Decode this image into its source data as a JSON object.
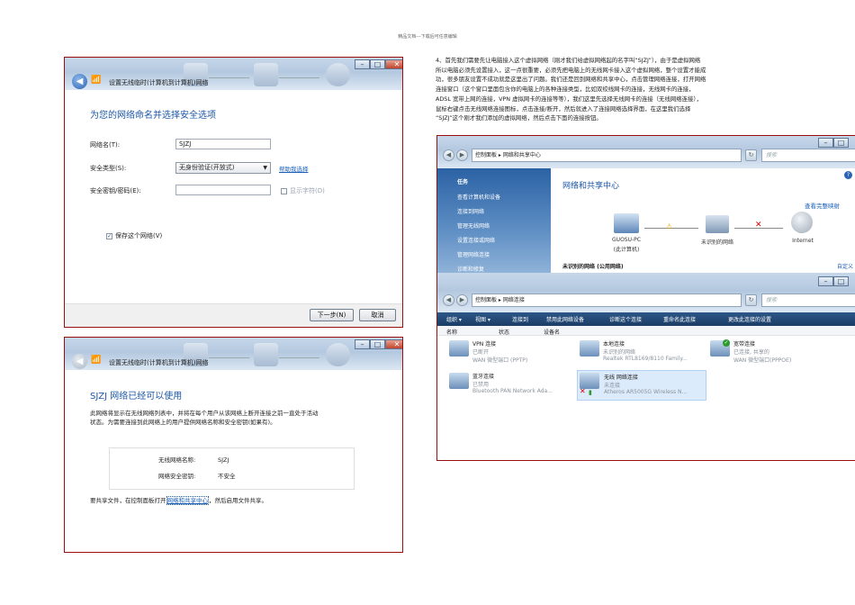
{
  "page_header": "精品文档---下载后可任意编辑",
  "win1": {
    "title": "设置无线临时(计算机到计算机)网络",
    "heading": "为您的网络命名并选择安全选项",
    "network_name_label": "网络名(T):",
    "network_name_value": "SJZJ",
    "security_type_label": "安全类型(S):",
    "security_type_value": "无身份验证(开放式)",
    "help_link": "帮助我选择",
    "security_key_label": "安全密钥/密码(E):",
    "show_chars_label": "显示字符(D)",
    "save_network_label": "保存这个网络(V)",
    "next_button": "下一步(N)",
    "cancel_button": "取消"
  },
  "win2": {
    "title": "设置无线临时(计算机到计算机)网络",
    "heading": "SJZJ 网络已经可以使用",
    "desc_line1": "此网络将显示在无线网络列表中，并将在每个用户从该网络上断开连接之前一直处于活动",
    "desc_line2": "状态。为需要连接到此网络上的用户提供网络名称和安全密钥(如果有)。",
    "name_label": "无线网络名称:",
    "name_value": "SJZJ",
    "key_label": "网络安全密钥:",
    "key_value": "不安全",
    "share_prefix": "要共享文件，在控制面板打开",
    "share_link": "网络和共享中心",
    "share_suffix": "，然后启用文件共享。"
  },
  "paragraph": {
    "line1": "4、首先我们需要先让电脑接入这个虚拟网络（刚才我们给虚拟网络起的名字叫“SJZJ”），由于是虚拟网络",
    "line2": "所以电脑必须先设置接入，这一点很重要，必须先把电脑上的无线网卡接入这个虚拟网络，整个设置才能成",
    "line3": "功，很多朋友设置不成功就是这里出了问题。我们还是回到网络和共享中心，点击管理网络连接，打开网络",
    "line4": "连接窗口（这个窗口里面包含你的电脑上的各种连接类型，比如双绞线网卡的连接，无线网卡的连接，",
    "line5": "ADSL 宽带上网的连接，VPN 虚拟网卡的连接等等），我们这里先选择无线网卡的连接（无线网络连接），",
    "line6": "鼠标右键点击无线网络连接图标，点击连接/断开，然后就进入了连接网络选择界面，在这里我们选择",
    "line7": "“SJZJ”这个刚才我们添加的虚拟网络，然后点击下面的连接按钮。"
  },
  "win3": {
    "breadcrumb": "控制面板 ▸ 网络和共享中心",
    "search_placeholder": "搜索",
    "sidebar": [
      "任务",
      "查看计算机和设备",
      "连接到网络",
      "管理无线网络",
      "设置连接或网络",
      "管理网络连接",
      "诊断和修复"
    ],
    "heading": "网络和共享中心",
    "view_full_map": "查看完整映射",
    "node_pc_line1": "GUOSU-PC",
    "node_pc_line2": "(此计算机)",
    "node_net": "未识别的网络",
    "node_internet": "Internet",
    "unidentified_row": "未识别的网络 (公用网络)",
    "customize": "自定义"
  },
  "win4": {
    "breadcrumb": "控制面板 ▸ 网络连接",
    "search_placeholder": "搜索",
    "toolbar": [
      "组织 ▾",
      "视图 ▾",
      "连接到",
      "禁用此网络设备",
      "诊断这个连接",
      "重命名此连接",
      "更改此连接的设置"
    ],
    "columns": [
      "名称",
      "状态",
      "设备名"
    ],
    "items": [
      {
        "name": "VPN 连接",
        "status": "已断开",
        "device": "WAN 微型端口 (PPTP)"
      },
      {
        "name": "本地连接",
        "status": "未识别的网络",
        "device": "Realtek RTL8169/8110 Family..."
      },
      {
        "name": "宽带连接",
        "status": "已连接, 共享的",
        "device": "WAN 微型端口(PPPOE)"
      },
      {
        "name": "蓝牙连接",
        "status": "已禁用",
        "device": "Bluetooth PAN Network Ada..."
      },
      {
        "name": "无线 网络连接",
        "status": "未连接",
        "device": "Atheros AR5005G Wireless N..."
      }
    ]
  },
  "colors": {
    "border": "#9a1010",
    "heading_blue": "#1d57a7",
    "link_blue": "#1b5fb8",
    "sidebar_blue": "#2b62a4"
  }
}
